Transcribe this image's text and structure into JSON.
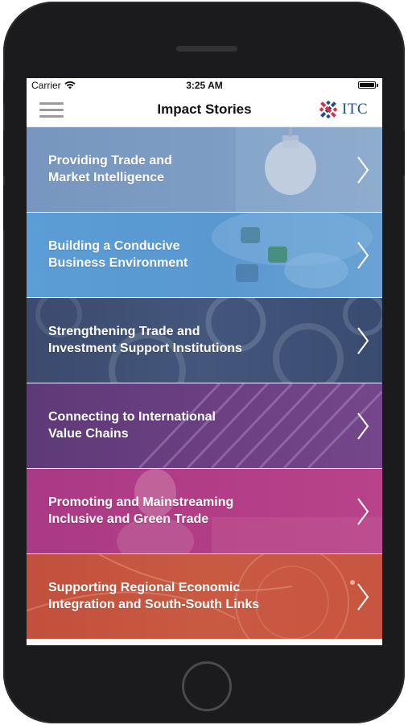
{
  "status_bar": {
    "carrier": "Carrier",
    "time": "3:25 AM"
  },
  "nav": {
    "title": "Impact Stories",
    "logo_text": "ITC"
  },
  "stories": [
    {
      "label": "Providing Trade and\nMarket Intelligence",
      "color": "#7b9ec4",
      "icon": "lightbulb-image"
    },
    {
      "label": "Building a Conducive\nBusiness Environment",
      "color": "#5a9ad3",
      "icon": "puzzle-hands-image"
    },
    {
      "label": "Strengthening Trade and\nInvestment Support Institutions",
      "color": "#3e4e73",
      "icon": "gears-image"
    },
    {
      "label": "Connecting to International\nValue Chains",
      "color": "#6a3c7e",
      "icon": "shipping-containers-image"
    },
    {
      "label": "Promoting and Mainstreaming\nInclusive and Green Trade",
      "color": "#b03c86",
      "icon": "woman-field-image"
    },
    {
      "label": "Supporting Regional Economic\nIntegration and South-South Links",
      "color": "#c8573f",
      "icon": "globe-map-image"
    }
  ],
  "colors": {
    "phone_frame": "#1b1b1d",
    "logo_blue": "#1f4f8a",
    "logo_red": "#d6304a"
  }
}
